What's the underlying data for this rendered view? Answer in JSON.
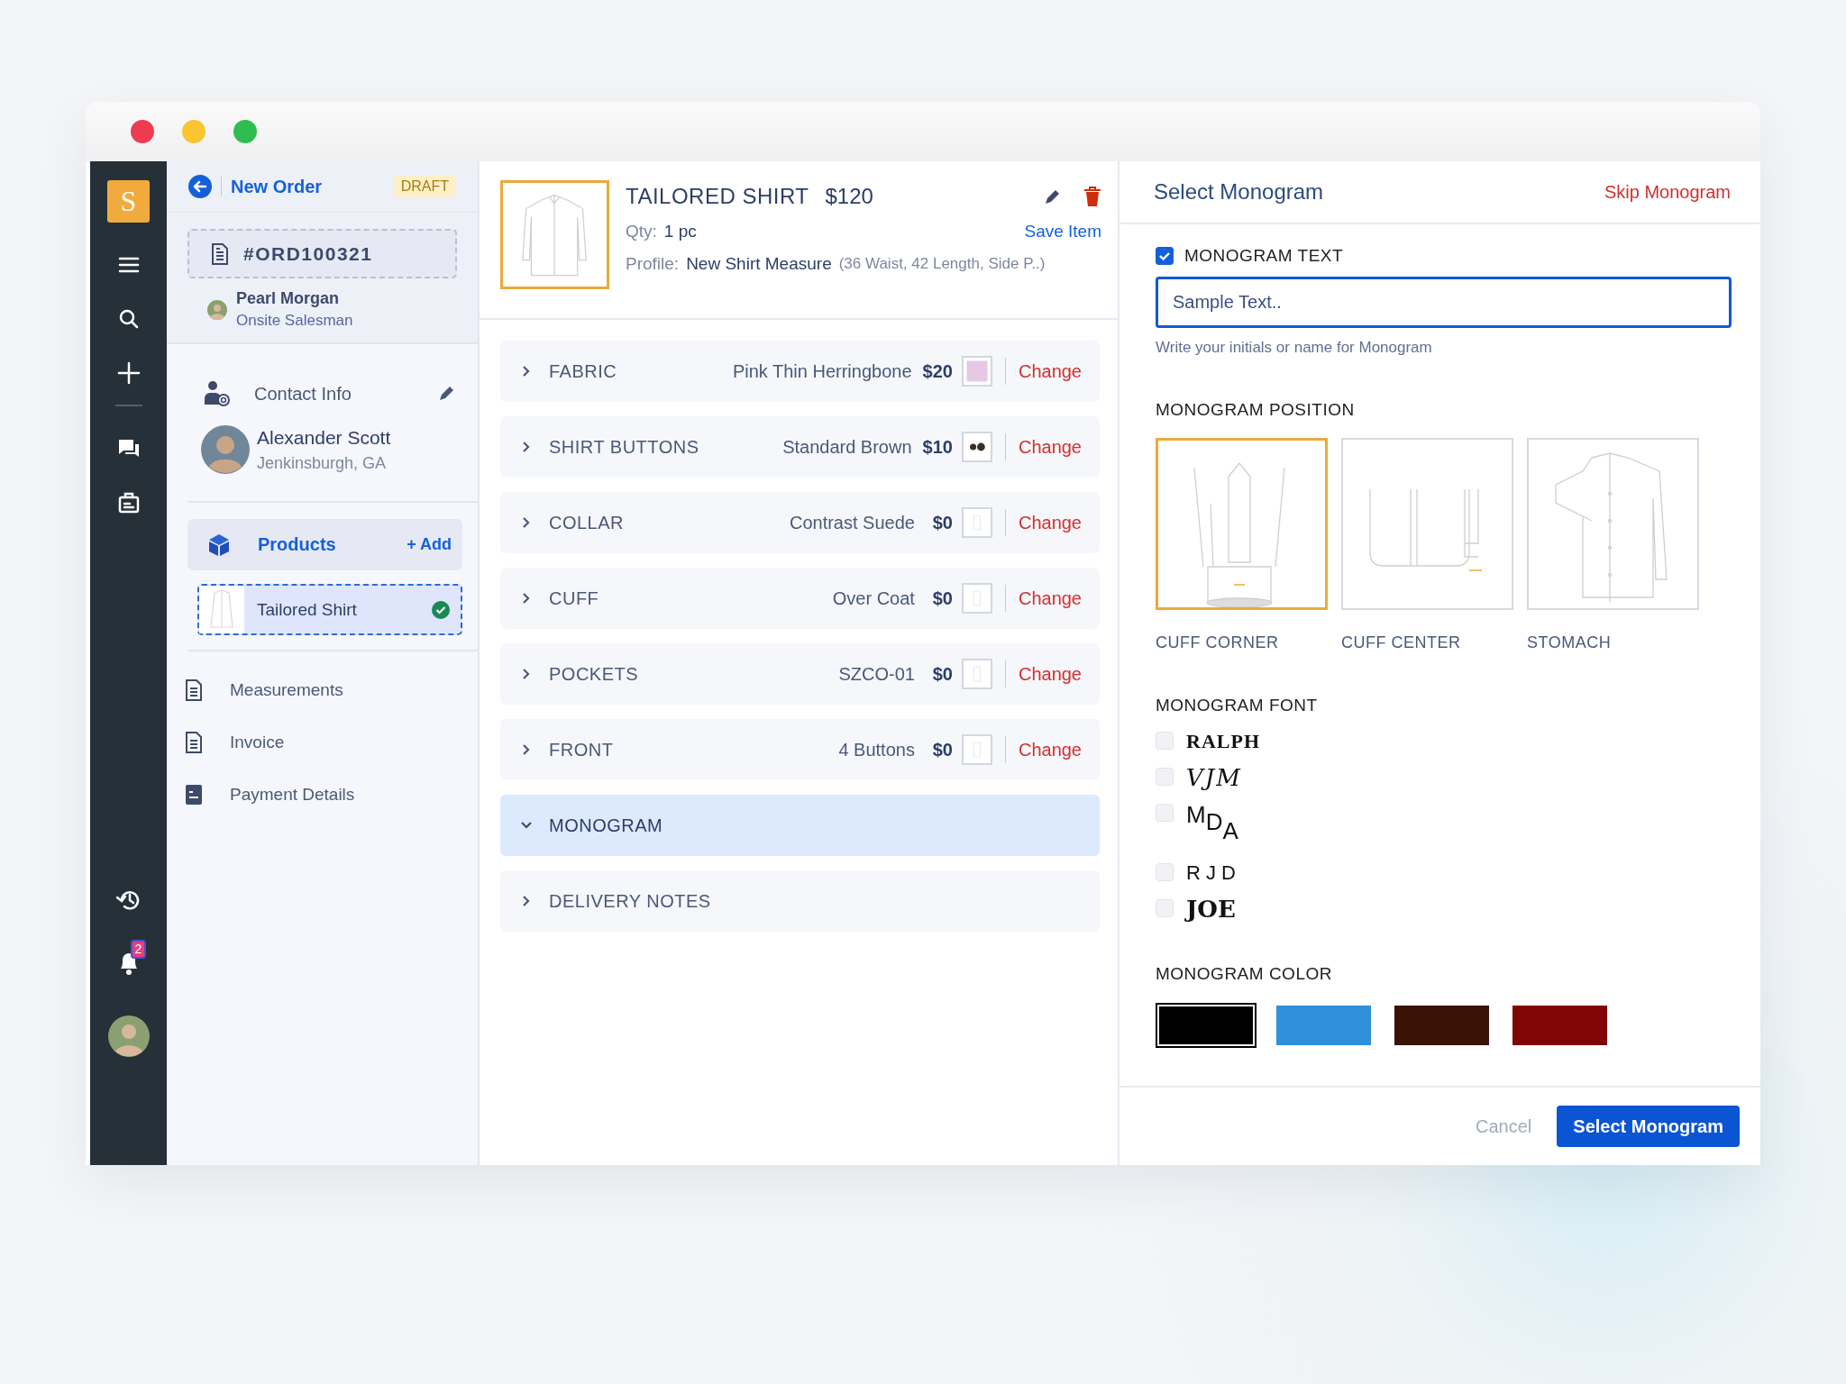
{
  "rail": {
    "logo": "S",
    "notifications": "2"
  },
  "sidebar": {
    "title": "New Order",
    "badge": "DRAFT",
    "order": "#ORD100321",
    "salesperson": {
      "name": "Pearl Morgan",
      "role": "Onsite Salesman"
    },
    "contact": {
      "title": "Contact Info"
    },
    "customer": {
      "name": "Alexander Scott",
      "location": "Jenkinsburgh, GA"
    },
    "products": {
      "title": "Products",
      "add": "+ Add",
      "selected": true,
      "items": [
        {
          "name": "Tailored Shirt",
          "selected": true,
          "done": true
        }
      ]
    },
    "nav": [
      {
        "label": "Measurements",
        "selected": false
      },
      {
        "label": "Invoice",
        "selected": false
      },
      {
        "label": "Payment Details",
        "selected": false
      }
    ]
  },
  "item": {
    "title": "TAILORED SHIRT",
    "price": "$120",
    "qty_label": "Qty:",
    "qty": "1 pc",
    "save": "Save Item",
    "profile_label": "Profile:",
    "profile": "New Shirt Measure",
    "profile_detail": "(36 Waist, 42 Length, Side P..)"
  },
  "options": [
    {
      "kind": "option",
      "label": "FABRIC",
      "value": "Pink Thin Herringbone",
      "price": "$20",
      "color": "#e6c8e4",
      "action": "Change",
      "expanded": false
    },
    {
      "kind": "option",
      "label": "SHIRT BUTTONS",
      "value": "Standard Brown",
      "price": "$10",
      "action": "Change",
      "expanded": false
    },
    {
      "kind": "option",
      "label": "COLLAR",
      "value": "Contrast Suede",
      "price": "$0",
      "action": "Change",
      "expanded": false
    },
    {
      "kind": "option",
      "label": "CUFF",
      "value": "Over Coat",
      "price": "$0",
      "action": "Change",
      "expanded": false
    },
    {
      "kind": "option",
      "label": "POCKETS",
      "value": "SZCO-01",
      "price": "$0",
      "action": "Change",
      "expanded": false
    },
    {
      "kind": "option",
      "label": "FRONT",
      "value": "4 Buttons",
      "price": "$0",
      "action": "Change",
      "expanded": false
    },
    {
      "kind": "section",
      "label": "MONOGRAM",
      "expanded": true
    },
    {
      "kind": "section",
      "label": "DELIVERY NOTES",
      "expanded": false
    }
  ],
  "monogram": {
    "title": "Select Monogram",
    "skip": "Skip Monogram",
    "text": {
      "label": "MONOGRAM TEXT",
      "checked": true,
      "placeholder": "Sample Text..",
      "hint": "Write your initials or name for Monogram"
    },
    "position_title": "MONOGRAM POSITION",
    "positions": [
      {
        "kind": "cuff_corner",
        "label": "CUFF CORNER",
        "selected": true
      },
      {
        "kind": "cuff_center",
        "label": "CUFF CENTER",
        "selected": false
      },
      {
        "kind": "stomach",
        "label": "STOMACH",
        "selected": false
      }
    ],
    "font_title": "MONOGRAM FONT",
    "fonts": [
      {
        "kind": "serif_bold",
        "text": "RALPH",
        "selected": false
      },
      {
        "kind": "script",
        "text": "VJM",
        "selected": false
      },
      {
        "kind": "stacked",
        "text": "M$_{D}$$_{A}$",
        "selected": false
      },
      {
        "kind": "spaced",
        "text": "R J D",
        "selected": false
      },
      {
        "kind": "blackletter",
        "text": "JOE",
        "selected": false
      }
    ],
    "color_title": "MONOGRAM COLOR",
    "colors": [
      {
        "color": "#000000",
        "selected": true
      },
      {
        "color": "#2f8fd8",
        "selected": false
      },
      {
        "color": "#3a1206",
        "selected": false
      },
      {
        "color": "#7f0604",
        "selected": false
      }
    ],
    "cancel": "Cancel",
    "confirm": "Select Monogram"
  }
}
